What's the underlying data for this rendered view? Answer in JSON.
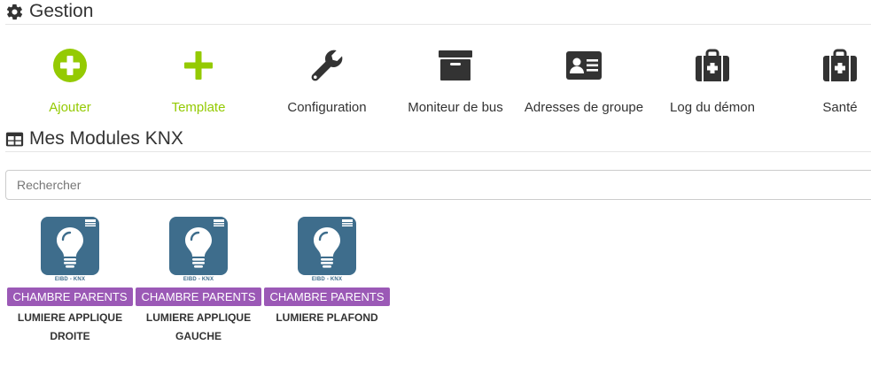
{
  "gestion": {
    "title": "Gestion",
    "icon": "gear-icon"
  },
  "actions": [
    {
      "label": "Ajouter",
      "icon": "plus-circle-icon",
      "color": "#94ca02"
    },
    {
      "label": "Template",
      "icon": "plus-icon",
      "color": "#94ca02"
    },
    {
      "label": "Configuration",
      "icon": "wrench-icon",
      "color": "#333333"
    },
    {
      "label": "Moniteur de bus",
      "icon": "archive-icon",
      "color": "#333333"
    },
    {
      "label": "Adresses de groupe",
      "icon": "address-card-icon",
      "color": "#333333"
    },
    {
      "label": "Log du démon",
      "icon": "medkit-icon",
      "color": "#333333"
    },
    {
      "label": "Santé",
      "icon": "medkit-icon",
      "color": "#333333"
    }
  ],
  "modules": {
    "title": "Mes Modules KNX",
    "icon": "table-icon"
  },
  "search": {
    "placeholder": "Rechercher",
    "value": ""
  },
  "devices": [
    {
      "object": "CHAMBRE PARENTS",
      "name": "LUMIERE APPLIQUE DROITE",
      "caption": "EIBD - KNX",
      "icon": "lightbulb-icon"
    },
    {
      "object": "CHAMBRE PARENTS",
      "name": "LUMIERE APPLIQUE GAUCHE",
      "caption": "EIBD - KNX",
      "icon": "lightbulb-icon"
    },
    {
      "object": "CHAMBRE PARENTS",
      "name": "LUMIERE PLAFOND",
      "caption": "EIBD - KNX",
      "icon": "lightbulb-icon"
    }
  ],
  "colors": {
    "accent_green": "#94ca02",
    "badge_purple": "#9b59b6",
    "tile_blue": "#3e6d8c"
  }
}
